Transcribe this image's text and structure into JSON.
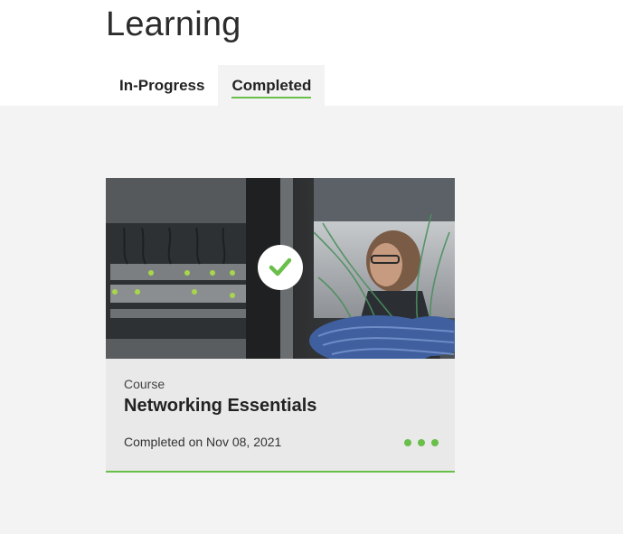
{
  "page": {
    "title": "Learning"
  },
  "tabs": [
    {
      "label": "In-Progress",
      "active": false
    },
    {
      "label": "Completed",
      "active": true
    }
  ],
  "card": {
    "image_icon": "check-icon",
    "type": "Course",
    "title": "Networking Essentials",
    "status": "Completed on Nov 08, 2021",
    "menu_icon": "more-dots-icon"
  },
  "colors": {
    "accent": "#6abf4b",
    "card_bg": "#e9e9e9",
    "page_bg": "#f3f3f3"
  }
}
